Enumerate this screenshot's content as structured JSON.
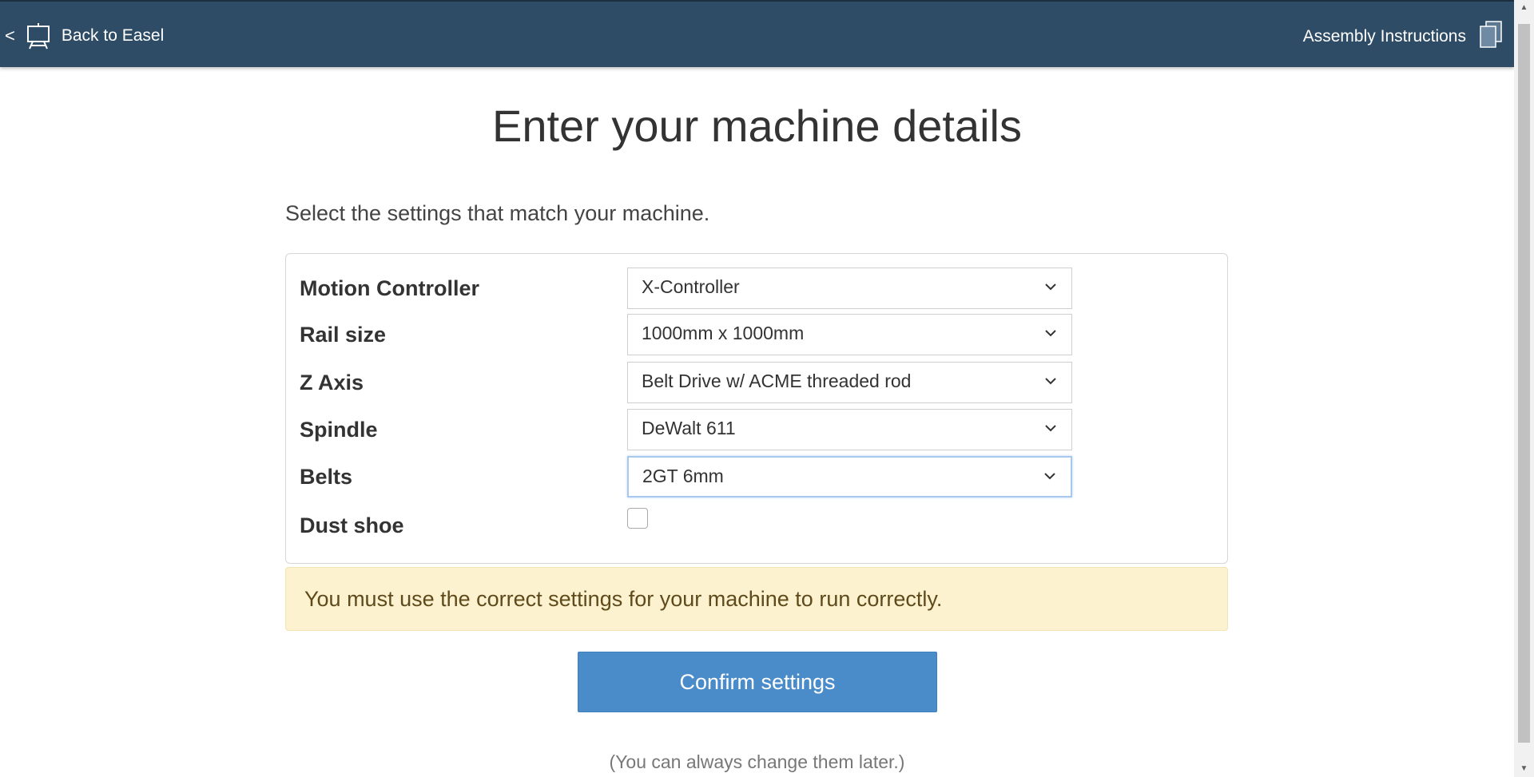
{
  "topbar": {
    "back_chevron": "<",
    "back_label": "Back to Easel",
    "assembly_label": "Assembly Instructions"
  },
  "page": {
    "title": "Enter your machine details",
    "subtitle": "Select the settings that match your machine."
  },
  "settings": [
    {
      "label": "Motion Controller",
      "value": "X-Controller"
    },
    {
      "label": "Rail size",
      "value": "1000mm x 1000mm"
    },
    {
      "label": "Z Axis",
      "value": "Belt Drive w/ ACME threaded rod"
    },
    {
      "label": "Spindle",
      "value": "DeWalt 611"
    },
    {
      "label": "Belts",
      "value": "2GT 6mm"
    }
  ],
  "dust_shoe": {
    "label": "Dust shoe",
    "checked": false
  },
  "warning": "You must use the correct settings for your machine to run correctly.",
  "confirm_label": "Confirm settings",
  "footnote": "(You can always change them later.)",
  "colors": {
    "topbar": "#2f4c66",
    "button": "#4a8cc9",
    "warning_bg": "#fcf2cf"
  }
}
